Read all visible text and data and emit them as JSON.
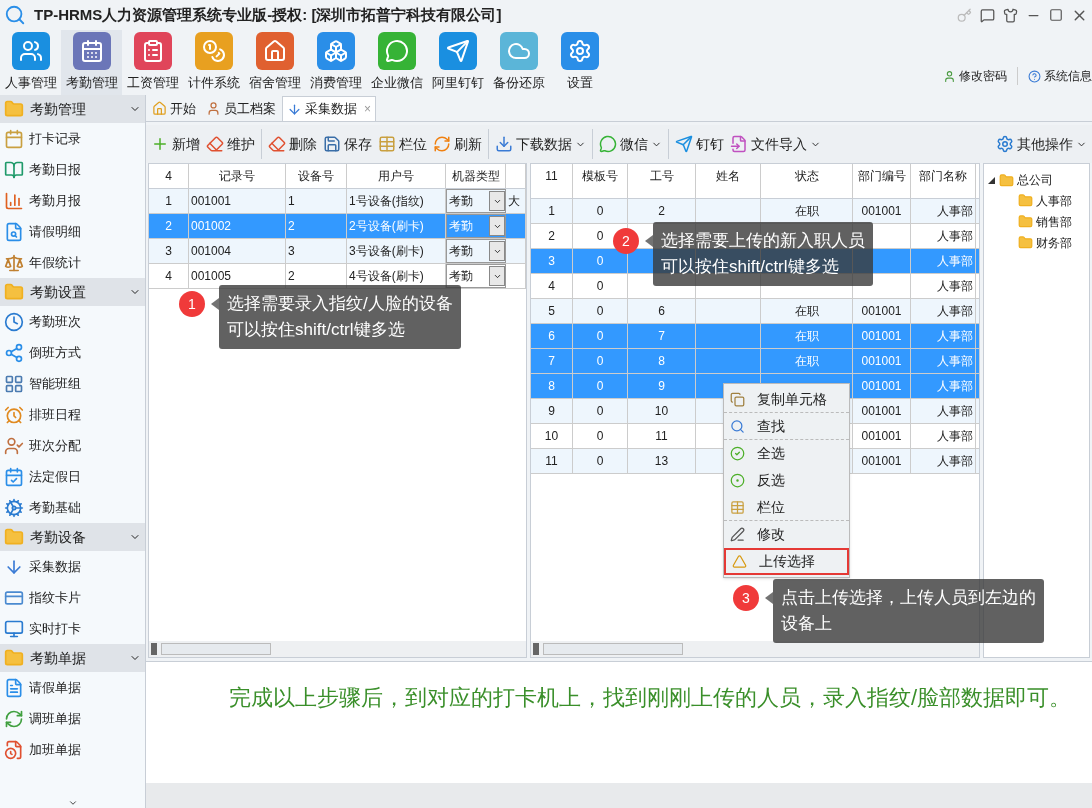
{
  "window": {
    "title": "TP-HRMS人力资源管理系统专业版-授权: [深圳市拓普宁科技有限公司]"
  },
  "modules": [
    {
      "label": "人事管理",
      "selected": false
    },
    {
      "label": "考勤管理",
      "selected": true
    },
    {
      "label": "工资管理",
      "selected": false
    },
    {
      "label": "计件系统",
      "selected": false
    },
    {
      "label": "宿舍管理",
      "selected": false
    },
    {
      "label": "消费管理",
      "selected": false
    },
    {
      "label": "企业微信",
      "selected": false
    },
    {
      "label": "阿里钉钉",
      "selected": false
    },
    {
      "label": "备份还原",
      "selected": false
    },
    {
      "label": "设置",
      "selected": false
    }
  ],
  "user_links": [
    "修改密码",
    "系统信息"
  ],
  "sidebar": {
    "groups": [
      {
        "label": "考勤管理",
        "items": [
          "打卡记录",
          "考勤日报",
          "考勤月报",
          "请假明细",
          "年假统计"
        ]
      },
      {
        "label": "考勤设置",
        "items": [
          "考勤班次",
          "倒班方式",
          "智能班组",
          "排班日程",
          "班次分配",
          "法定假日",
          "考勤基础"
        ]
      },
      {
        "label": "考勤设备",
        "items": [
          "采集数据",
          "指纹卡片",
          "实时打卡"
        ]
      },
      {
        "label": "考勤单据",
        "items": [
          "请假单据",
          "调班单据",
          "加班单据"
        ]
      }
    ]
  },
  "tabs": [
    {
      "label": "开始",
      "selected": false,
      "closable": false
    },
    {
      "label": "员工档案",
      "selected": false,
      "closable": false
    },
    {
      "label": "采集数据",
      "selected": true,
      "closable": true,
      "close": "×"
    }
  ],
  "toolbar": [
    {
      "label": "新增",
      "dropdown": false,
      "separator_before": false
    },
    {
      "label": "维护",
      "dropdown": false,
      "separator_before": false
    },
    {
      "label": "删除",
      "dropdown": false,
      "separator_before": true
    },
    {
      "label": "保存",
      "dropdown": false,
      "separator_before": false
    },
    {
      "label": "栏位",
      "dropdown": false,
      "separator_before": false
    },
    {
      "label": "刷新",
      "dropdown": false,
      "separator_before": false
    },
    {
      "label": "下载数据",
      "dropdown": true,
      "separator_before": true
    },
    {
      "label": "微信",
      "dropdown": true,
      "separator_before": true
    },
    {
      "label": "钉钉",
      "dropdown": false,
      "separator_before": true
    },
    {
      "label": "文件导入",
      "dropdown": true,
      "separator_before": false
    }
  ],
  "toolbar_right": {
    "label": "其他操作",
    "dropdown": true
  },
  "device_grid": {
    "columns": [
      "4",
      "记录号",
      "设备号",
      "用户号",
      "机器类型",
      ""
    ],
    "rows": [
      {
        "cells": [
          "1",
          "001001",
          "1",
          "1号设备(指纹)",
          "考勤",
          "大"
        ],
        "selected": false
      },
      {
        "cells": [
          "2",
          "001002",
          "2",
          "2号设备(刷卡)",
          "考勤",
          ""
        ],
        "selected": true
      },
      {
        "cells": [
          "3",
          "001004",
          "3",
          "3号设备(刷卡)",
          "考勤",
          ""
        ],
        "selected": false
      },
      {
        "cells": [
          "4",
          "001005",
          "2",
          "4号设备(刷卡)",
          "考勤",
          ""
        ],
        "selected": false
      }
    ]
  },
  "employee_grid": {
    "columns": [
      "11",
      "模板号",
      "工号",
      "姓名",
      "状态",
      "部门编号",
      "部门名称"
    ],
    "rows": [
      {
        "cells": [
          "1",
          "0",
          "2",
          "",
          "在职",
          "001001",
          "人事部"
        ],
        "selected": false
      },
      {
        "cells": [
          "2",
          "0",
          "",
          "",
          "",
          "",
          "人事部"
        ],
        "selected": false
      },
      {
        "cells": [
          "3",
          "0",
          "",
          "",
          "",
          "",
          "人事部"
        ],
        "selected": true
      },
      {
        "cells": [
          "4",
          "0",
          "",
          "",
          "",
          "",
          "人事部"
        ],
        "selected": false
      },
      {
        "cells": [
          "5",
          "0",
          "6",
          "",
          "在职",
          "001001",
          "人事部"
        ],
        "selected": false
      },
      {
        "cells": [
          "6",
          "0",
          "7",
          "",
          "在职",
          "001001",
          "人事部"
        ],
        "selected": true
      },
      {
        "cells": [
          "7",
          "0",
          "8",
          "",
          "在职",
          "001001",
          "人事部"
        ],
        "selected": true
      },
      {
        "cells": [
          "8",
          "0",
          "9",
          "",
          "",
          "001001",
          "人事部"
        ],
        "selected": true
      },
      {
        "cells": [
          "9",
          "0",
          "10",
          "",
          "",
          "001001",
          "人事部"
        ],
        "selected": false
      },
      {
        "cells": [
          "10",
          "0",
          "11",
          "",
          "",
          "001001",
          "人事部"
        ],
        "selected": false
      },
      {
        "cells": [
          "11",
          "0",
          "13",
          "",
          "",
          "001001",
          "人事部"
        ],
        "selected": false
      }
    ]
  },
  "org_tree": {
    "label": "总公司",
    "expanded": true,
    "children": [
      {
        "label": "人事部"
      },
      {
        "label": "销售部"
      },
      {
        "label": "财务部"
      }
    ]
  },
  "context_menu": [
    {
      "label": "复制单元格",
      "separator_after": true,
      "highlighted": false
    },
    {
      "label": "查找",
      "separator_after": true,
      "highlighted": false
    },
    {
      "label": "全选",
      "separator_after": false,
      "highlighted": false
    },
    {
      "label": "反选",
      "separator_after": false,
      "highlighted": false
    },
    {
      "label": "栏位",
      "separator_after": true,
      "highlighted": false
    },
    {
      "label": "修改",
      "separator_after": false,
      "highlighted": false
    },
    {
      "label": "上传选择",
      "separator_after": false,
      "highlighted": true
    }
  ],
  "callouts": [
    {
      "number": "1",
      "lines": [
        "选择需要录入指纹/人脸的设备",
        "可以按住shift/ctrl键多选"
      ]
    },
    {
      "number": "2",
      "lines": [
        "选择需要上传的新入职人员",
        "可以按住shift/ctrl键多选"
      ]
    },
    {
      "number": "3",
      "lines": [
        "点击上传选择，上传人员到左边的",
        "设备上"
      ]
    }
  ],
  "note": "完成以上步骤后，到对应的打卡机上，找到刚刚上传的人员，录入指纹/脸部数据即可。"
}
